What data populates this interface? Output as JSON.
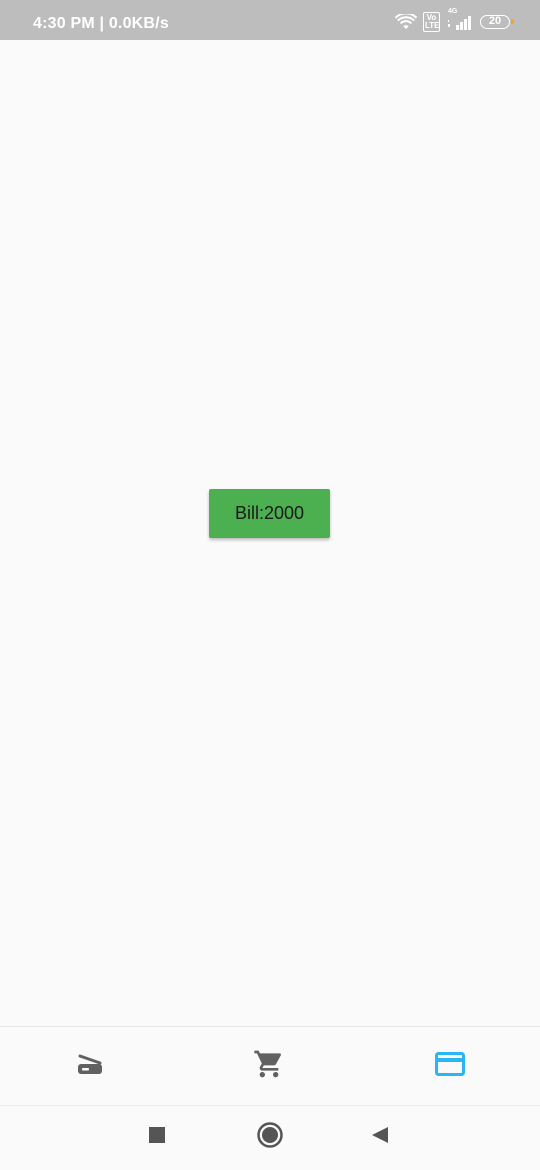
{
  "status_bar": {
    "time_speed": "4:30 PM | 0.0KB/s",
    "network_type": "4G",
    "volte_label": "Vo LTE",
    "battery_level": "20",
    "battery_tip_color": "#f5a623"
  },
  "main": {
    "bill_button_label": "Bill:2000",
    "bill_button_color": "#4caf50"
  },
  "bottom_nav": {
    "items": [
      {
        "icon": "scanner-icon",
        "active": false
      },
      {
        "icon": "shopping-cart-icon",
        "active": false
      },
      {
        "icon": "credit-card-icon",
        "active": true
      }
    ],
    "active_color": "#29b6f6",
    "inactive_color": "#616161"
  },
  "system_nav": {
    "items": [
      "recents-square-icon",
      "home-circle-icon",
      "back-triangle-icon"
    ]
  }
}
